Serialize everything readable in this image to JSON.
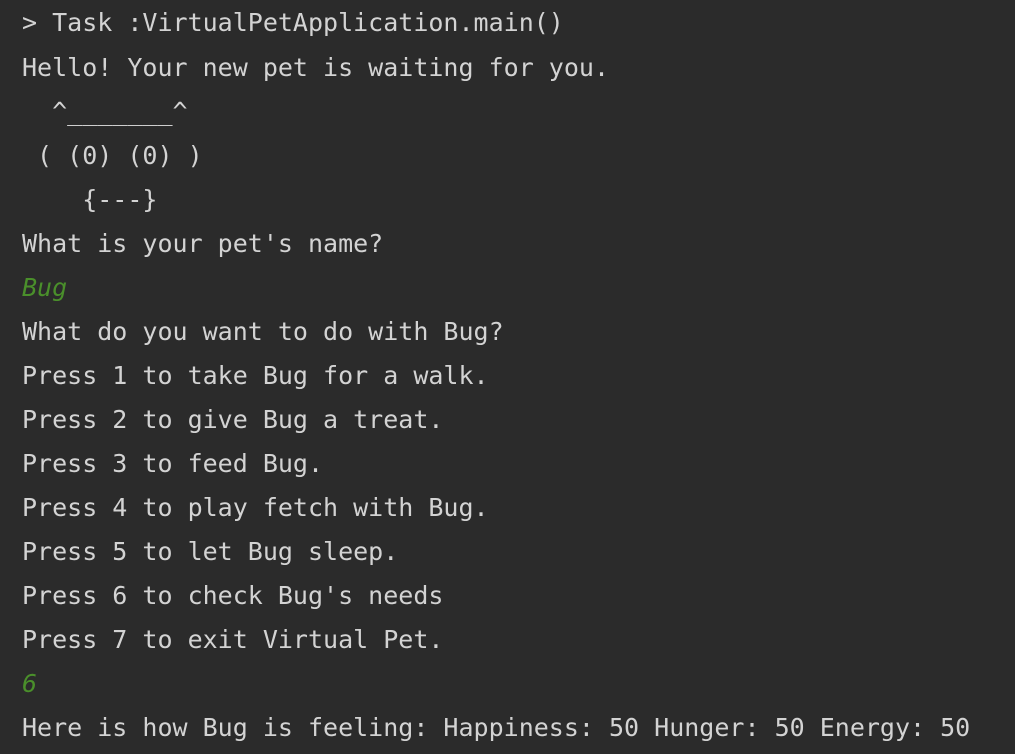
{
  "console": {
    "lines": [
      {
        "text": "> Task :VirtualPetApplication.main()",
        "type": "output"
      },
      {
        "text": "Hello! Your new pet is waiting for you.",
        "type": "output"
      },
      {
        "text": "  ^_______^",
        "type": "output"
      },
      {
        "text": " ( (0) (0) )",
        "type": "output"
      },
      {
        "text": "    {---}",
        "type": "output"
      },
      {
        "text": "What is your pet's name?",
        "type": "output"
      },
      {
        "text": "Bug",
        "type": "input"
      },
      {
        "text": "What do you want to do with Bug?",
        "type": "output"
      },
      {
        "text": "Press 1 to take Bug for a walk.",
        "type": "output"
      },
      {
        "text": "Press 2 to give Bug a treat.",
        "type": "output"
      },
      {
        "text": "Press 3 to feed Bug.",
        "type": "output"
      },
      {
        "text": "Press 4 to play fetch with Bug.",
        "type": "output"
      },
      {
        "text": "Press 5 to let Bug sleep.",
        "type": "output"
      },
      {
        "text": "Press 6 to check Bug's needs",
        "type": "output"
      },
      {
        "text": "Press 7 to exit Virtual Pet.",
        "type": "output"
      },
      {
        "text": "6",
        "type": "input"
      },
      {
        "text": "Here is how Bug is feeling: Happiness: 50 Hunger: 50 Energy: 50",
        "type": "output"
      }
    ]
  },
  "colors": {
    "background": "#2b2b2b",
    "output_text": "#d3d3d3",
    "user_input_text": "#4a8f2b"
  }
}
